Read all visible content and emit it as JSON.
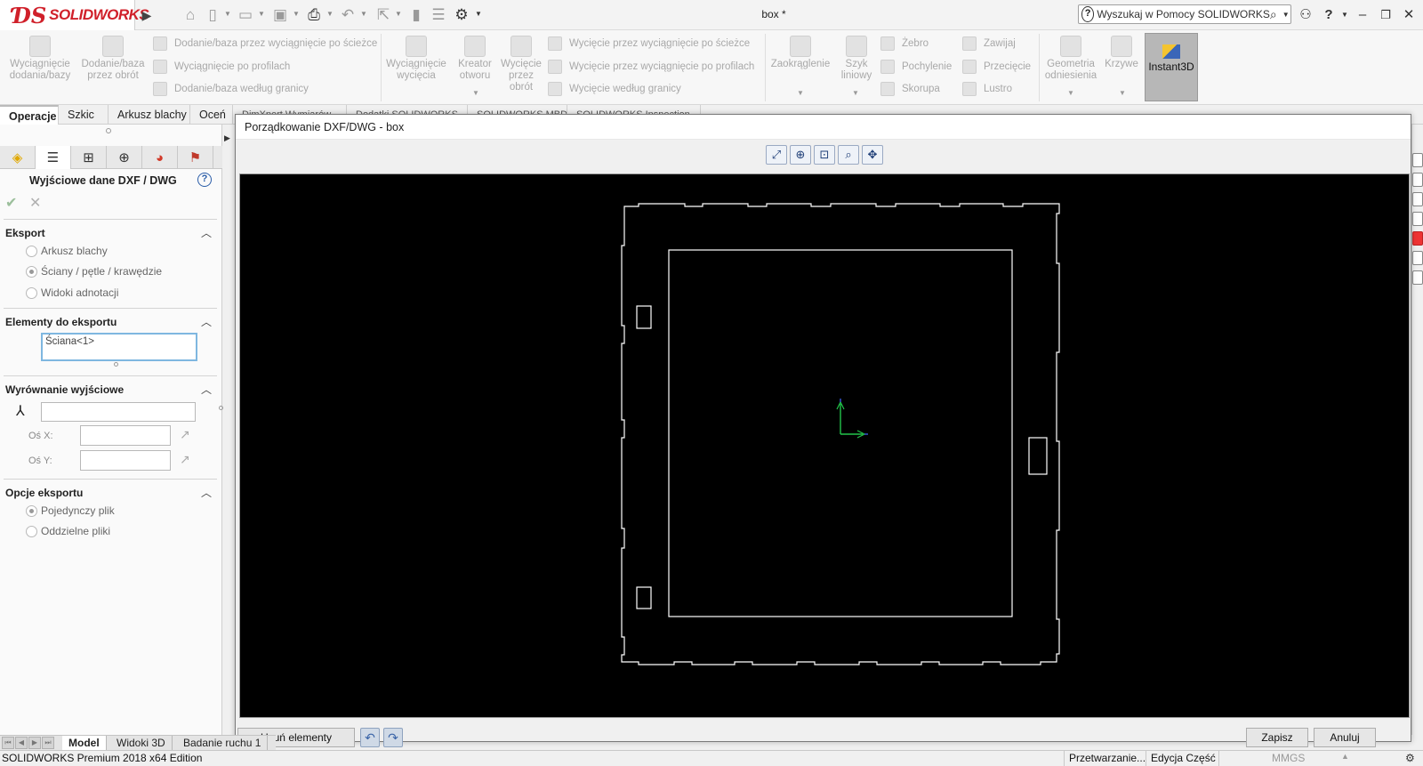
{
  "app": {
    "logo_text": "SOLIDWORKS",
    "document_title": "box *"
  },
  "help_search": {
    "placeholder": "Wyszukaj w Pomocy SOLIDWORKS"
  },
  "ribbon": {
    "extrude_boss": "Wyciągnięcie dodania/bazy",
    "revolve_boss": "Dodanie/baza przez obrót",
    "swept_boss": "Dodanie/baza przez wyciągnięcie po ścieżce",
    "lofted_boss": "Wyciągnięcie po profilach",
    "boundary_boss": "Dodanie/baza według granicy",
    "extruded_cut": "Wyciągnięcie wycięcia",
    "hole_wizard": "Kreator otworu",
    "revolved_cut": "Wycięcie przez obrót",
    "swept_cut": "Wycięcie przez wyciągnięcie po ścieżce",
    "lofted_cut": "Wycięcie przez wyciągnięcie po profilach",
    "boundary_cut": "Wycięcie według granicy",
    "fillet": "Zaokrąglenie",
    "linear_pattern": "Szyk liniowy",
    "rib": "Żebro",
    "draft": "Pochylenie",
    "shell": "Skorupa",
    "wrap": "Zawijaj",
    "intersect": "Przecięcie",
    "mirror": "Lustro",
    "reference_geometry": "Geometria odniesienia",
    "curves": "Krzywe",
    "instant3d": "Instant3D"
  },
  "command_tabs": [
    "Operacje",
    "Szkic",
    "Arkusz blachy",
    "Oceń",
    "DimXpert Wymiarów",
    "Dodatki SOLIDWORKS",
    "SOLIDWORKS MBD",
    "SOLIDWORKS Inspection"
  ],
  "property_manager": {
    "title": "Wyjściowe dane DXF / DWG",
    "export_group": "Eksport",
    "export_options": [
      {
        "label": "Arkusz blachy",
        "selected": false
      },
      {
        "label": "Ściany / pętle / krawędzie",
        "selected": true
      },
      {
        "label": "Widoki adnotacji",
        "selected": false
      }
    ],
    "entities_group": "Elementy do eksportu",
    "entities_selection": "Ściana<1>",
    "alignment_group": "Wyrównanie wyjściowe",
    "alignment_value": "",
    "axis_x_label": "Oś X:",
    "axis_x_value": "",
    "axis_y_label": "Oś Y:",
    "axis_y_value": "",
    "options_group": "Opcje eksportu",
    "file_options": [
      {
        "label": "Pojedynczy plik",
        "selected": true
      },
      {
        "label": "Oddzielne pliki",
        "selected": false
      }
    ]
  },
  "dialog": {
    "title": "Porządkowanie DXF/DWG - box",
    "remove_entities": "Usuń elementy",
    "save": "Zapisz",
    "cancel": "Anuluj"
  },
  "bottom_tabs": [
    "Model",
    "Widoki 3D",
    "Badanie ruchu 1"
  ],
  "status": {
    "edition": "SOLIDWORKS Premium 2018 x64 Edition",
    "processing": "Przetwarzanie...",
    "mode": "Edycja Część",
    "units": "MMGS"
  },
  "colors": {
    "brand_red": "#d0202a",
    "canvas_bg": "#000000",
    "geometry": "#ffffff",
    "axis_x": "#22c44a",
    "axis_y": "#3b5bdb",
    "selection_border": "#7fb7e0"
  },
  "icons": {
    "toolbar": [
      "home-icon",
      "new-document-icon",
      "open-icon",
      "save-icon",
      "print-icon",
      "undo-icon",
      "select-icon",
      "rebuild-icon",
      "file-properties-icon",
      "options-icon"
    ],
    "view_tools": [
      "zoom-to-fit-icon",
      "zoom-in-icon",
      "zoom-area-icon",
      "zoom-previous-icon",
      "pan-icon"
    ]
  }
}
